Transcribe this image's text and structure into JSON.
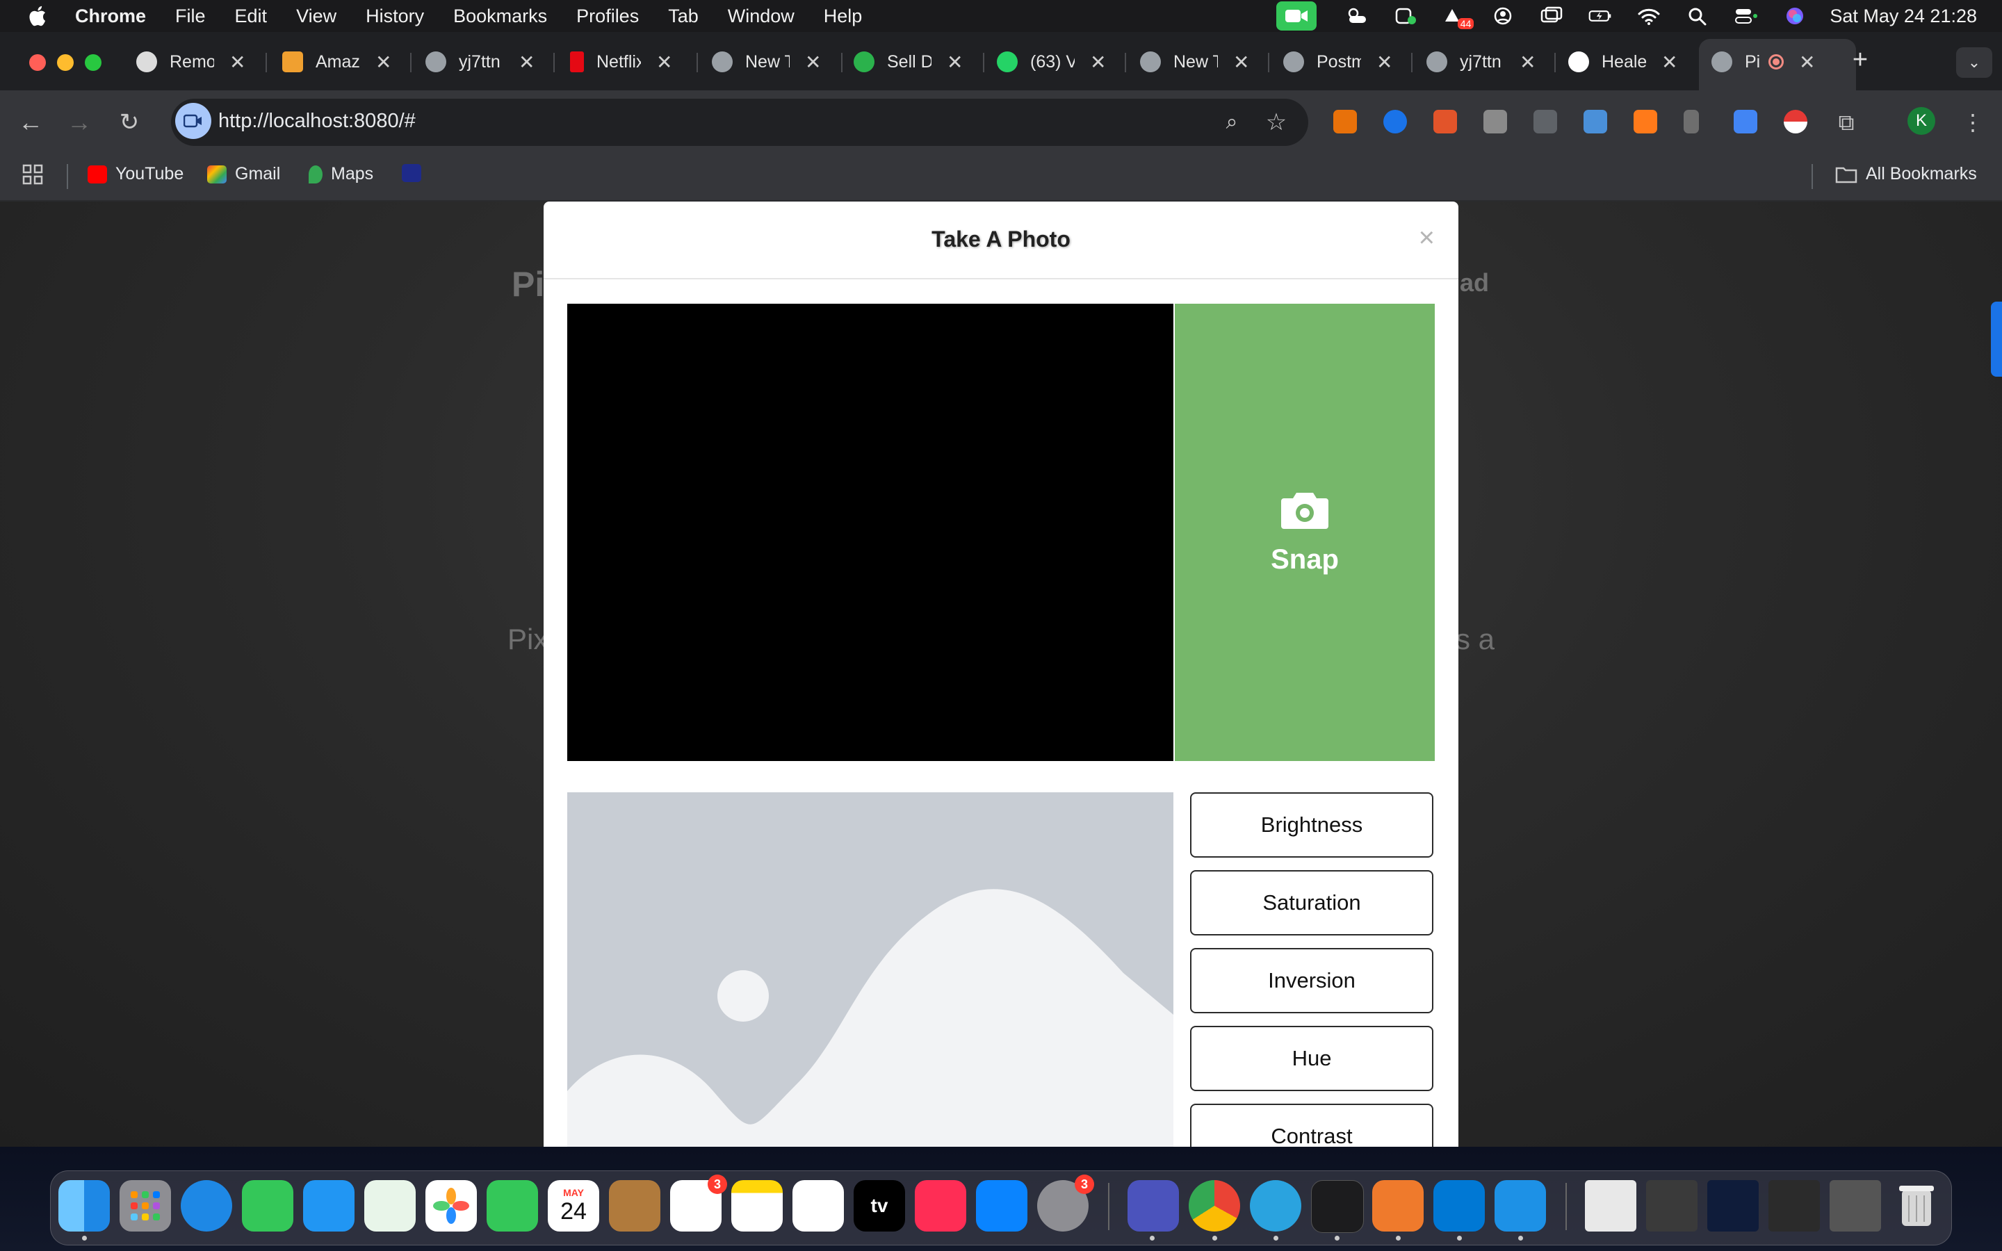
{
  "menubar": {
    "app_name": "Chrome",
    "items": [
      "File",
      "Edit",
      "View",
      "History",
      "Bookmarks",
      "Profiles",
      "Tab",
      "Window",
      "Help"
    ],
    "battery_badge": "44",
    "clock": "Sat May 24  21:28"
  },
  "tabs": [
    {
      "label": "Remo",
      "color": "#dcdcdc"
    },
    {
      "label": "Amaz",
      "color": "#f0a030"
    },
    {
      "label": "yj7ttn",
      "color": "#9aa0a6"
    },
    {
      "label": "Netflix",
      "color": "#e50914"
    },
    {
      "label": "New T",
      "color": "#9aa0a6"
    },
    {
      "label": "Sell D",
      "color": "#2bb24c"
    },
    {
      "label": "(63) V",
      "color": "#25d366"
    },
    {
      "label": "New T",
      "color": "#9aa0a6"
    },
    {
      "label": "Postm",
      "color": "#9aa0a6"
    },
    {
      "label": "yj7ttn",
      "color": "#9aa0a6"
    },
    {
      "label": "Heale",
      "color": "#ffffff"
    },
    {
      "label": "Pi",
      "color": "#9aa0a6"
    }
  ],
  "toolbar": {
    "url": "http://localhost:8080/#"
  },
  "bookmarks": {
    "items": [
      {
        "label": "YouTube",
        "color": "#ff0000"
      },
      {
        "label": "Gmail",
        "color": "#ea4335"
      },
      {
        "label": "Maps",
        "color": "#34a853"
      }
    ],
    "all_bookmarks": "All Bookmarks",
    "profile_initial": "K"
  },
  "background_page": {
    "title_left": "Pi",
    "title_right": "ad",
    "text_left": "Pix",
    "text_right": "s a"
  },
  "modal": {
    "title": "Take A Photo",
    "close": "×",
    "snap_label": "Snap",
    "filters": [
      "Brightness",
      "Saturation",
      "Inversion",
      "Hue",
      "Contrast"
    ],
    "snap_color": "#76b76a"
  },
  "dock": {
    "calendar_month": "MAY",
    "calendar_day": "24",
    "reminders_badge": "3",
    "settings_badge": "3",
    "tv_label": "tv"
  }
}
